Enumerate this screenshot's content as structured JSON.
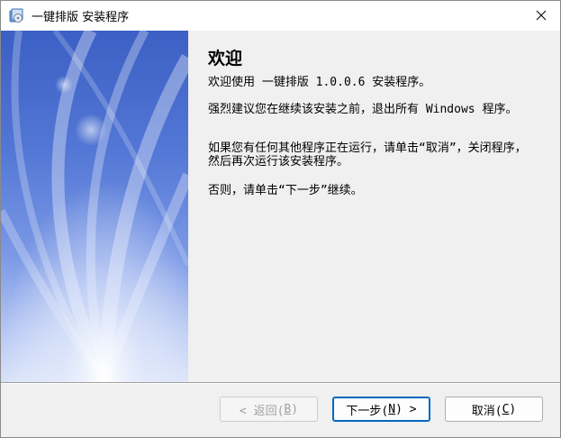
{
  "window": {
    "title": "一键排版 安装程序"
  },
  "welcome": {
    "heading": "欢迎",
    "line1": "欢迎使用 一键排版 1.0.0.6 安装程序。",
    "line2": "强烈建议您在继续该安装之前，退出所有 Windows 程序。",
    "line3": "如果您有任何其他程序正在运行，请单击“取消”，关闭程序，然后再次运行该安装程序。",
    "line4": "否则，请单击“下一步”继续。"
  },
  "buttons": {
    "back_prefix": "< 返回(",
    "back_key": "B",
    "back_suffix": ")",
    "next_prefix": "下一步(",
    "next_key": "N",
    "next_suffix": ") >",
    "cancel_prefix": "取消(",
    "cancel_key": "C",
    "cancel_suffix": ")"
  },
  "icons": {
    "app": "installer-app-icon",
    "close": "close-icon"
  },
  "colors": {
    "banner_top": "#3b5fc4",
    "banner_bottom": "#d7e1f8",
    "default_button_border": "#0067c0"
  }
}
